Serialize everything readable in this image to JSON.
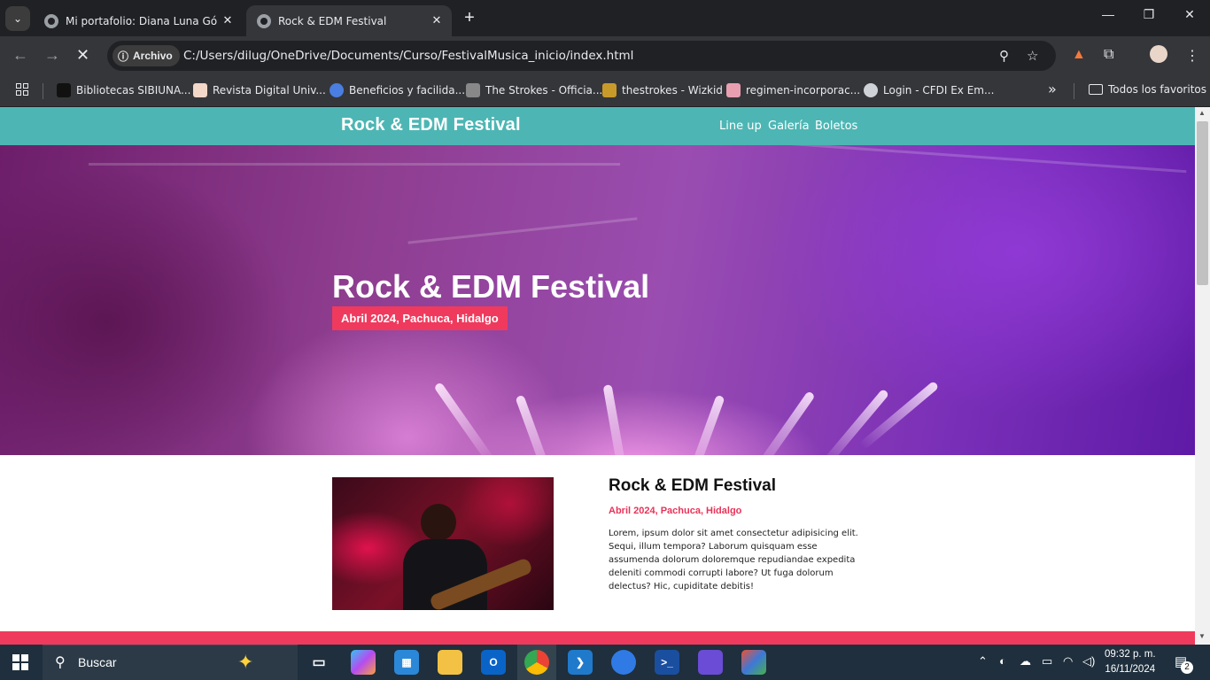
{
  "browser": {
    "tabs": [
      {
        "title": "Mi portafolio: Diana Luna Góme",
        "close": "✕"
      },
      {
        "title": "Rock & EDM Festival",
        "close": "✕"
      }
    ],
    "new_tab": "+",
    "window_controls": {
      "minimize": "—",
      "restore": "❐",
      "close": "✕"
    },
    "address": {
      "chip": "Archivo",
      "url": "C:/Users/dilug/OneDrive/Documents/Curso/FestivalMusica_inicio/index.html"
    },
    "bookmarks": [
      {
        "label": "Bibliotecas SIBIUNA...",
        "color": "#111111"
      },
      {
        "label": "Revista Digital Univ...",
        "color": "#f3d7c8"
      },
      {
        "label": "Beneficios y facilida...",
        "color": "#4a7ee0"
      },
      {
        "label": "The Strokes - Officia...",
        "color": "#888888"
      },
      {
        "label": "thestrokes - Wizkid",
        "color": "#c79a2a"
      },
      {
        "label": "regimen-incorporac...",
        "color": "#e8a0b0"
      },
      {
        "label": "Login - CFDI Ex Em...",
        "color": "#cfd3d8"
      }
    ],
    "bookmarks_more": "»",
    "all_bookmarks": "Todos los favoritos"
  },
  "site": {
    "brand": "Rock & EDM Festival",
    "nav": [
      "Line up",
      "Galería",
      "Boletos"
    ],
    "hero": {
      "title": "Rock & EDM Festival",
      "badge": "Abril 2024, Pachuca, Hidalgo"
    },
    "info": {
      "title": "Rock & EDM Festival",
      "date": "Abril 2024, Pachuca, Hidalgo",
      "description": "Lorem, ipsum dolor sit amet consectetur adipisicing elit. Sequi, illum tempora? Laborum quisquam esse assumenda dolorum doloremque repudiandae expedita deleniti commodi corrupti labore? Ut fuga dolorum delectus? Hic, cupiditate debitis!"
    }
  },
  "taskbar": {
    "search_label": "Buscar",
    "clock": {
      "time": "09:32 p. m.",
      "date": "16/11/2024"
    },
    "notification_count": "2"
  },
  "colors": {
    "header_teal": "#4db6b4",
    "accent_red": "#ef3a5d"
  }
}
